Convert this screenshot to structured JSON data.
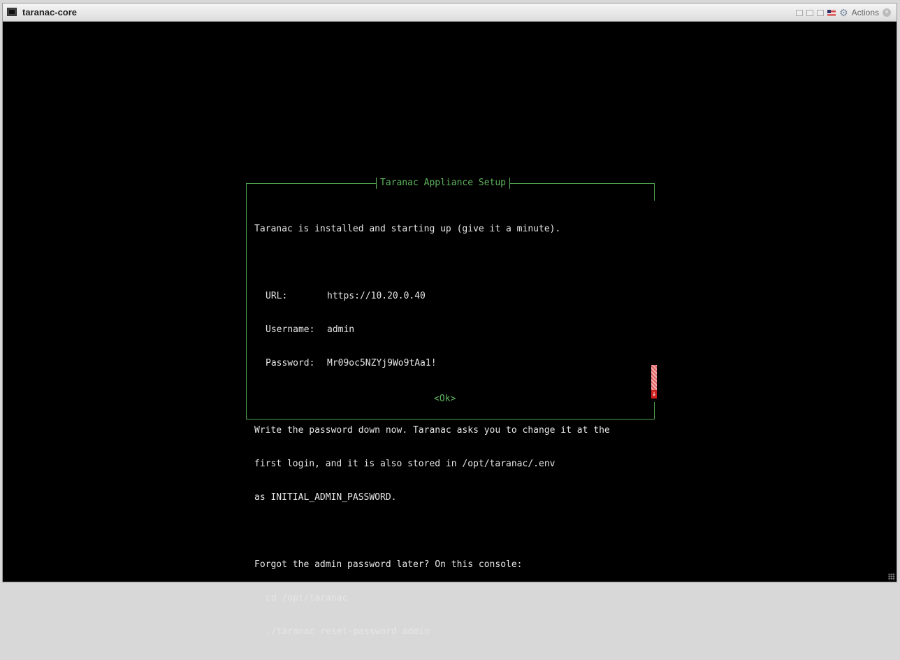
{
  "window": {
    "title": "taranac-core",
    "actions_label": "Actions"
  },
  "dialog": {
    "title": "Taranac Appliance Setup",
    "intro": "Taranac is installed and starting up (give it a minute).",
    "credentials": [
      {
        "key": "URL:",
        "value": "https://10.20.0.40"
      },
      {
        "key": "Username:",
        "value": "admin"
      },
      {
        "key": "Password:",
        "value": "Mr09oc5NZYj9Wo9tAa1!"
      }
    ],
    "notice_lines": [
      "Write the password down now. Taranac asks you to change it at the",
      "first login, and it is also stored in /opt/taranac/.env",
      "as INITIAL_ADMIN_PASSWORD."
    ],
    "forgot_line": "Forgot the admin password later? On this console:",
    "commands": [
      "cd /opt/taranac",
      "./taranac reset-password admin"
    ],
    "ok_label": "<Ok>"
  },
  "colors": {
    "console_bg": "#000000",
    "dialog_border": "#4fa04f",
    "dialog_text": "#e6e6e6",
    "accent_green": "#5fb35f",
    "scrollbar_red": "#d02020"
  },
  "icons": {
    "console": "console-icon",
    "gear": "gear-icon",
    "close": "close-icon",
    "scroll_down": "arrow-down-icon"
  }
}
